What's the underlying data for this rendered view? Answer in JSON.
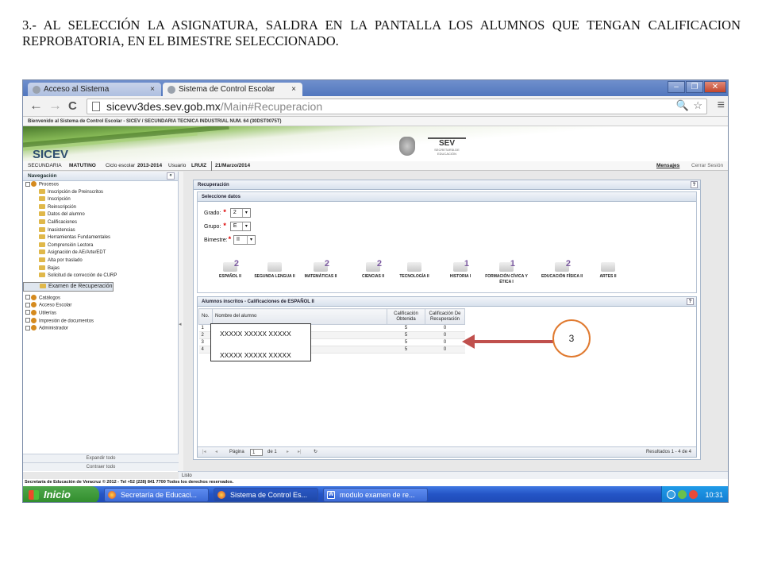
{
  "caption": "3.- AL SELECCIÓN LA ASIGNATURA, SALDRA EN LA PANTALLA LOS ALUMNOS QUE TENGAN CALIFICACION REPROBATORIA, EN EL BIMESTRE SELECCIONADO.",
  "browser": {
    "tabs": [
      {
        "label": "Acceso al Sistema",
        "active": false
      },
      {
        "label": "Sistema de Control Escolar",
        "active": true
      }
    ],
    "url_host": "sicevv3des.sev.gob.mx",
    "url_path": "/Main#Recuperacion",
    "nav": {
      "back": "←",
      "forward": "→",
      "reload": "C"
    }
  },
  "site": {
    "welcome": "Bienvenido al Sistema de Control Escolar - SICEV / SECUNDARIA TECNICA INDUSTRIAL NUM. 64 (30DST0075T)",
    "logo": "SICEV",
    "sev_logo": "SEV",
    "sev_sub": "SECRETARÍA DE EDUCACIÓN",
    "info": {
      "nivel": "SECUNDARIA",
      "turno": "MATUTINO",
      "ciclo_label": "Ciclo escolar",
      "ciclo": "2013-2014",
      "usuario_label": "Usuario",
      "usuario": "LRUIZ",
      "fecha": "21/Marzo/2014",
      "mensajes": "Mensajes",
      "cerrar": "Cerrar Sesión"
    }
  },
  "leftnav": {
    "title": "Navegación",
    "collapse": "«",
    "procesos": "Procesos",
    "items": [
      "Inscripción de Preinscritos",
      "Inscripción",
      "Reinscripción",
      "Datos del alumno",
      "Calificaciones",
      "Inasistencias",
      "Herramientas Fundamentales",
      "Comprensión Lectora",
      "Asignación de AE/Arte/EDT",
      "Alta por traslado",
      "Bajas",
      "Solicitud de corrección de CURP",
      "Examen de Recuperación"
    ],
    "groups": [
      "Catálogos",
      "Acceso Escolar",
      "Utilerías",
      "Impresión de documentos",
      "Administrador"
    ],
    "expand": "Expandir todo",
    "contract": "Contraer todo"
  },
  "main": {
    "title": "Recuperación",
    "help": "?",
    "select_title": "Seleccione datos",
    "grado_label": "Grado:",
    "grado_value": "2",
    "grupo_label": "Grupo:",
    "grupo_value": "E",
    "bimestre_label": "Bimestre:",
    "bimestre_value": "II",
    "required": "*",
    "subjects": [
      {
        "label": "ESPAÑOL II",
        "num": "2"
      },
      {
        "label": "SEGUNDA LENGUA II",
        "num": ""
      },
      {
        "label": "MATEMÁTICAS II",
        "num": "2"
      },
      {
        "label": "CIENCIAS II",
        "num": "2"
      },
      {
        "label": "TECNOLOGÍA II",
        "num": ""
      },
      {
        "label": "HISTORIA I",
        "num": "1"
      },
      {
        "label": "FORMACIÓN CÍVICA Y ÉTICA I",
        "num": "1"
      },
      {
        "label": "EDUCACIÓN FÍSICA II",
        "num": "2"
      },
      {
        "label": "ARTES II",
        "num": ""
      }
    ]
  },
  "grid": {
    "title": "Alumnos inscritos - Calificaciones de ESPAÑOL II",
    "columns": [
      "No.",
      "Nombre del alumno",
      "Calificación Obtenida",
      "Calificación De Recuperación"
    ],
    "rows": [
      {
        "no": "1",
        "cal": "5",
        "rec": "0"
      },
      {
        "no": "2",
        "cal": "5",
        "rec": "0"
      },
      {
        "no": "3",
        "cal": "5",
        "rec": "0"
      },
      {
        "no": "4",
        "cal": "5",
        "rec": "0"
      }
    ],
    "pager": {
      "page_label": "Página",
      "page": "1",
      "of": "de 1",
      "results": "Resultados 1 - 4 de 4"
    }
  },
  "status": "Listo",
  "footer": "Secretaría de Educación de Veracruz © 2012 - Tel +52 (228) 841 7700 Todos los derechos reservados.",
  "taskbar": {
    "start": "Inicio",
    "tasks": [
      "Secretaría de Educaci...",
      "Sistema de Control Es...",
      "modulo examen de re..."
    ],
    "clock": "10:31"
  },
  "overlay": {
    "names": [
      "XXXXX XXXXX XXXXX",
      "XXXXX XXXXX XXXXX"
    ],
    "marker": "3"
  }
}
